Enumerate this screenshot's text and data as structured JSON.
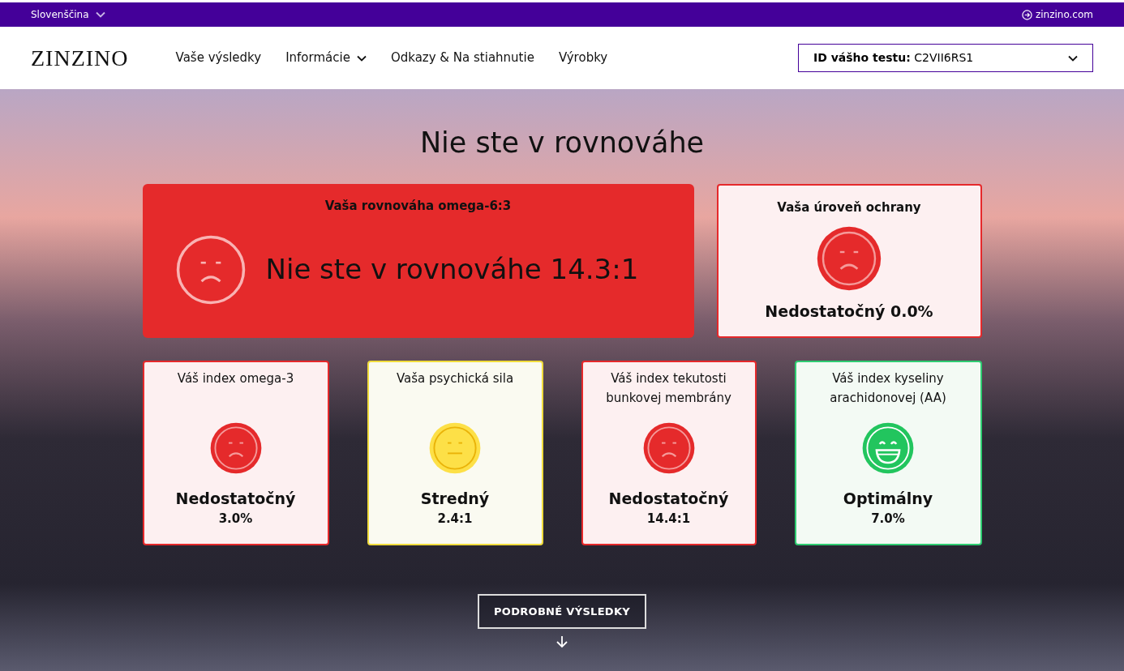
{
  "top_bar": {
    "language": "Slovenščina",
    "site_link": "zinzino.com"
  },
  "nav": {
    "logo": "ZINZINO",
    "items": [
      {
        "label": "Vaše výsledky",
        "dropdown": false
      },
      {
        "label": "Informácie",
        "dropdown": true
      },
      {
        "label": "Odkazy & Na stiahnutie",
        "dropdown": false
      },
      {
        "label": "Výrobky",
        "dropdown": false
      }
    ],
    "test_id": {
      "label": "ID vášho testu:",
      "value": "C2VII6RS1"
    }
  },
  "hero": {
    "title": "Nie ste v rovnováhe",
    "overview": {
      "title": "Vaša rovnováha omega-6:3",
      "kind": "poor",
      "result": "Nie ste v rovnováhe 14.3:1"
    },
    "protection": {
      "title": "Vaša úroveň ochrany",
      "kind": "poor",
      "result": "Nedostatočný 0.0%"
    },
    "cards": [
      {
        "title": "Váš index omega-3",
        "kind": "poor",
        "rating": "Nedostatočný",
        "value": "3.0%"
      },
      {
        "title": "Vaša psychická sila",
        "kind": "medium",
        "rating": "Stredný",
        "value": "2.4:1"
      },
      {
        "title": "Váš index tekutosti bunkovej membrány",
        "kind": "poor",
        "rating": "Nedostatočný",
        "value": "14.4:1"
      },
      {
        "title": "Váš index kyseliny arachidonovej (AA)",
        "kind": "optimal",
        "rating": "Optimálny",
        "value": "7.0%"
      }
    ],
    "details_button": "PODROBNÉ VÝSLEDKY"
  }
}
